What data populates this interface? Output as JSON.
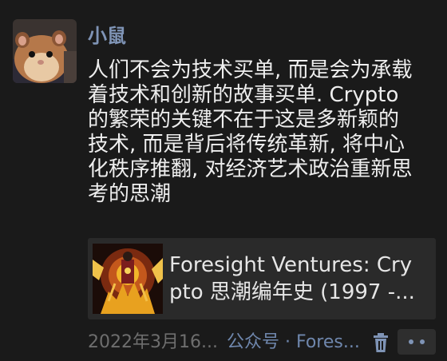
{
  "post": {
    "username": "小鼠",
    "text": "人们不会为技术买单, 而是会为承载\n着技术和创新的故事买单. Crypto\n的繁荣的关键不在于这是多新颖的\n技术, 而是背后将传统革新, 将中心\n化秩序推翻, 对经济艺术政治重新思\n考的思潮",
    "link_card": {
      "title": "Foresight Ventures: Cry\npto 思潮编年史 (1997 -..."
    },
    "timestamp": "2022年3月16...",
    "source": "公众号 · Fores...",
    "icons": {
      "avatar": "hamster-avatar",
      "thumbnail": "foresight-article-thumbnail",
      "delete": "trash-icon",
      "more": "more-dots-icon"
    },
    "colors": {
      "background": "#1a1a1a",
      "username": "#7f94b6",
      "link": "#6f87ad",
      "text": "#eeeeee",
      "muted": "#6e6e6e",
      "card": "#2a2a2a"
    }
  }
}
